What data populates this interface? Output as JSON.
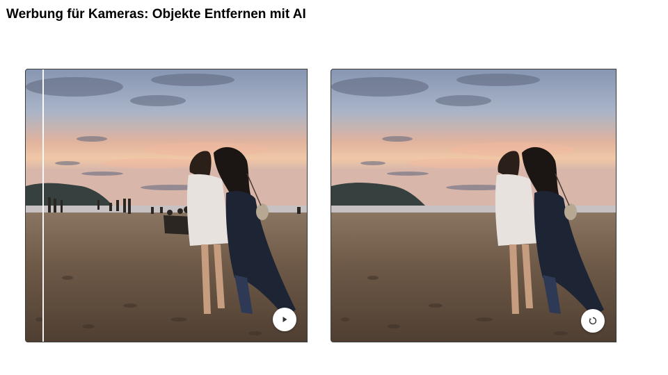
{
  "slide": {
    "title": "Werbung für Kameras: Objekte Entfernen mit AI"
  },
  "before_photo": {
    "control_icon": "play-icon"
  },
  "after_photo": {
    "control_icon": "replay-icon"
  },
  "colors": {
    "sky_top": "#8e9cb6",
    "sky_glow": "#e9b49a",
    "sea": "#c9c3c4",
    "sand": "#6e5a48",
    "dress_white": "#e8e2df",
    "dress_navy": "#1d2433"
  }
}
